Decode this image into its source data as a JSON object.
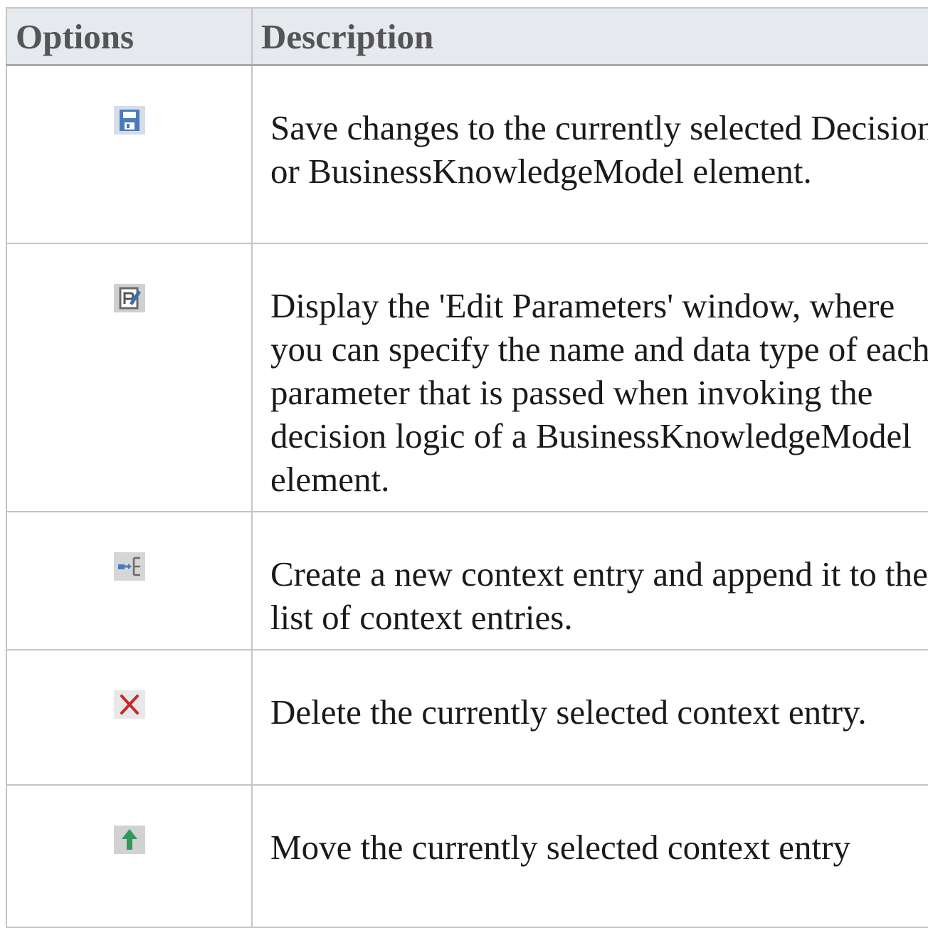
{
  "table": {
    "headers": {
      "options": "Options",
      "description": "Description"
    },
    "rows": [
      {
        "icon": "save-icon",
        "description": "Save changes to the currently selected Decision or BusinessKnowledgeModel element."
      },
      {
        "icon": "edit-parameters-icon",
        "description": "Display the 'Edit Parameters' window, where you can specify the name and data type of each parameter that is passed when invoking the decision logic of a BusinessKnowledgeModel element."
      },
      {
        "icon": "add-context-entry-icon",
        "description": "Create a new context entry and append it to the list of context entries."
      },
      {
        "icon": "delete-icon",
        "description": "Delete the currently selected context entry."
      },
      {
        "icon": "move-up-icon",
        "description": "Move the currently selected context entry"
      }
    ]
  },
  "colors": {
    "header_background": "#e6e9ee",
    "header_text": "#555555",
    "border": "#c4c4c4",
    "icon_blue": "#4a7ab8",
    "delete_red": "#c8282d",
    "move_up_green": "#2e9a55"
  }
}
